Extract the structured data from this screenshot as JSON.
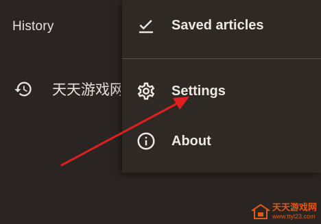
{
  "left_panel": {
    "title": "History",
    "item_label": "天天游戏网",
    "item_icon": "history-icon"
  },
  "menu": {
    "items": [
      {
        "label": "Saved articles",
        "icon": "check-icon"
      },
      {
        "label": "Settings",
        "icon": "gear-icon"
      },
      {
        "label": "About",
        "icon": "info-icon"
      }
    ]
  },
  "annotation": {
    "arrow_color": "#e02020"
  },
  "watermark": {
    "text": "天天游戏网",
    "url": "www.ttyl23.com",
    "color": "#e05a1a"
  },
  "colors": {
    "background": "#2a2522",
    "menu_background": "#2f2926",
    "text": "#e7e2de"
  }
}
